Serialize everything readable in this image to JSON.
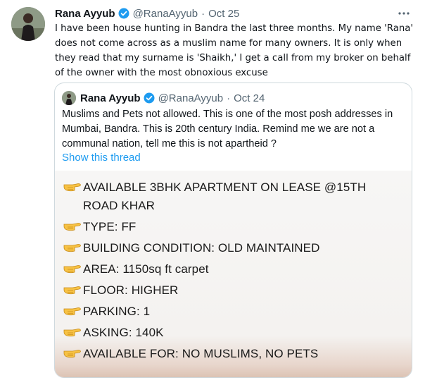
{
  "tweet": {
    "author_name": "Rana Ayyub",
    "handle": "@RanaAyyub",
    "date": "Oct 25",
    "text": "I have been house hunting in Bandra the last three months.  My name 'Rana' does not come across as a muslim name for many owners. It is only when they read that my surname is 'Shaikh,'  I get a call from my broker on behalf of the owner with the most obnoxious excuse"
  },
  "quoted_tweet": {
    "author_name": "Rana Ayyub",
    "handle": "@RanaAyyub",
    "date": "Oct 24",
    "text": "Muslims and Pets not allowed. This is one of the most posh addresses in Mumbai, Bandra. This is 20th century India. Remind me we are not a communal nation, tell me this is not apartheid ?",
    "show_thread_label": "Show this thread",
    "image_lines": [
      "AVAILABLE 3BHK APARTMENT ON LEASE @15TH",
      "ROAD KHAR",
      "TYPE: FF",
      "BUILDING CONDITION: OLD MAINTAINED",
      "AREA: 1150sq ft carpet",
      "FLOOR: HIGHER",
      "PARKING: 1",
      "ASKING: 140K",
      "AVAILABLE FOR: NO MUSLIMS, NO PETS"
    ]
  },
  "icons": {
    "verified": "verified-badge-icon",
    "more": "more-options-icon",
    "hand": "pointing-hand-emoji-icon"
  },
  "colors": {
    "accent": "#1d9bf0",
    "muted": "#536471",
    "border": "#cfd9de"
  }
}
